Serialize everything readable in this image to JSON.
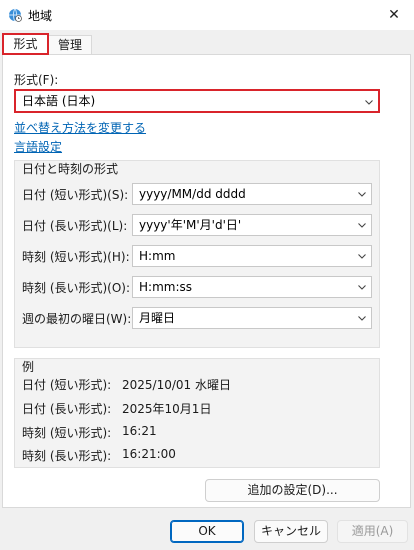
{
  "window": {
    "title": "地域",
    "close_glyph": "✕",
    "icon": "globe-clock-icon"
  },
  "tabs": [
    {
      "label": "形式",
      "selected": true
    },
    {
      "label": "管理",
      "selected": false
    }
  ],
  "format": {
    "label": "形式(F):",
    "value": "日本語 (日本)"
  },
  "links": {
    "sort": "並べ替え方法を変更する",
    "language": "言語設定"
  },
  "datetime_group": {
    "title": "日付と時刻の形式",
    "rows": [
      {
        "label": "日付 (短い形式)(S):",
        "value": "yyyy/MM/dd dddd"
      },
      {
        "label": "日付 (長い形式)(L):",
        "value": "yyyy'年'M'月'd'日'"
      },
      {
        "label": "時刻 (短い形式)(H):",
        "value": "H:mm"
      },
      {
        "label": "時刻 (長い形式)(O):",
        "value": "H:mm:ss"
      },
      {
        "label": "週の最初の曜日(W):",
        "value": "月曜日"
      }
    ]
  },
  "example_group": {
    "title": "例",
    "rows": [
      {
        "label": "日付 (短い形式):",
        "value": "2025/10/01 水曜日"
      },
      {
        "label": "日付 (長い形式):",
        "value": "2025年10月1日"
      },
      {
        "label": "時刻 (短い形式):",
        "value": "16:21"
      },
      {
        "label": "時刻 (長い形式):",
        "value": "16:21:00"
      }
    ]
  },
  "buttons": {
    "additional": "追加の設定(D)...",
    "ok": "OK",
    "cancel": "キャンセル",
    "apply": "適用(A)"
  },
  "colors": {
    "highlight": "#d9242b",
    "link": "#0064b4",
    "ok_border": "#0067c0"
  }
}
